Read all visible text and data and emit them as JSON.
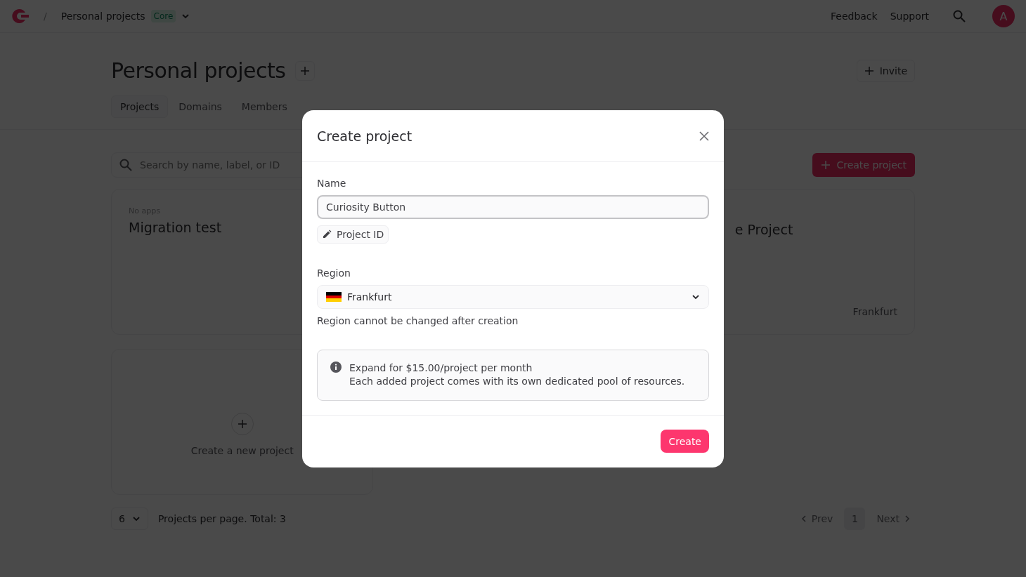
{
  "topbar": {
    "separator": "/",
    "breadcrumb": "Personal projects",
    "plan_badge": "Core",
    "links": [
      "Feedback",
      "Support"
    ],
    "avatar_initial": "A"
  },
  "header": {
    "title": "Personal projects",
    "invite_button": "Invite"
  },
  "tabs": [
    {
      "label": "Projects",
      "selected": true
    },
    {
      "label": "Domains",
      "selected": false
    },
    {
      "label": "Members",
      "selected": false
    }
  ],
  "search": {
    "placeholder": "Search by name, label, or ID"
  },
  "create_button": "Create project",
  "projects": [
    {
      "kind": "project",
      "apps": "No apps",
      "title": "Migration test"
    },
    {
      "kind": "covered"
    },
    {
      "kind": "project",
      "title": "e Project",
      "region": "Frankfurt",
      "peek": true
    },
    {
      "kind": "new",
      "label": "Create a new project"
    }
  ],
  "pagination": {
    "per_page": "6",
    "summary": "Projects per page. Total: 3",
    "prev": "Prev",
    "page": "1",
    "next": "Next"
  },
  "dialog": {
    "title": "Create project",
    "name_label": "Name",
    "name_value": "Curiosity Button",
    "project_id_button": "Project ID",
    "region_label": "Region",
    "region_value": "Frankfurt",
    "region_hint": "Region cannot be changed after creation",
    "info_title": "Expand for $15.00/project per month",
    "info_text": "Each added project comes with its own dedicated pool of resources.",
    "submit": "Create"
  }
}
